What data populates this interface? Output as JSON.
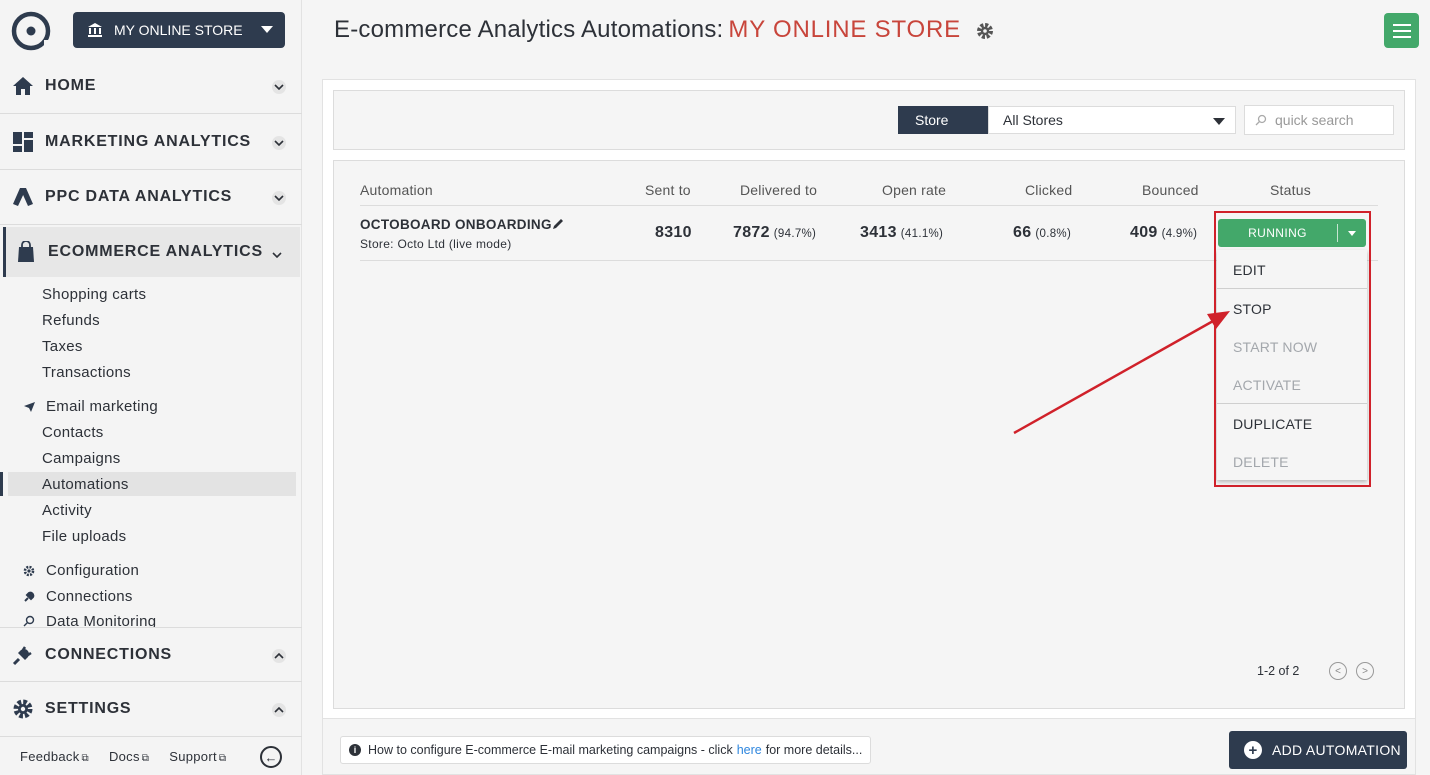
{
  "store_selector": {
    "label": "MY ONLINE STORE"
  },
  "nav": {
    "home": "HOME",
    "marketing": "MARKETING ANALYTICS",
    "ppc": "PPC DATA ANALYTICS",
    "ecommerce": "ECOMMERCE ANALYTICS",
    "ecom_items": [
      "Shopping carts",
      "Refunds",
      "Taxes",
      "Transactions"
    ],
    "email_marketing": "Email marketing",
    "email_items": [
      "Contacts",
      "Campaigns",
      "Automations",
      "Activity",
      "File uploads"
    ],
    "configuration": "Configuration",
    "connections_sub": "Connections",
    "data_monitoring": "Data Monitoring",
    "connections": "CONNECTIONS",
    "settings": "SETTINGS"
  },
  "footer": {
    "feedback": "Feedback",
    "docs": "Docs",
    "support": "Support"
  },
  "header": {
    "title": "E-commerce Analytics Automations:",
    "store": "MY ONLINE STORE"
  },
  "filter": {
    "store_label": "Store",
    "store_value": "All Stores",
    "search_placeholder": "quick search"
  },
  "table": {
    "headers": [
      "Automation",
      "Sent to",
      "Delivered to",
      "Open rate",
      "Clicked",
      "Bounced",
      "Status"
    ],
    "row": {
      "name": "OCTOBOARD ONBOARDING",
      "store": "Store: Octo Ltd (live mode)",
      "sent": "8310",
      "delivered": "7872",
      "delivered_pct": "(94.7%)",
      "open": "3413",
      "open_pct": "(41.1%)",
      "clicked": "66",
      "clicked_pct": "(0.8%)",
      "bounced": "409",
      "bounced_pct": "(4.9%)",
      "status": "RUNNING"
    }
  },
  "dropdown": {
    "edit": "EDIT",
    "stop": "STOP",
    "start_now": "START NOW",
    "activate": "ACTIVATE",
    "duplicate": "DUPLICATE",
    "delete": "DELETE"
  },
  "pager": {
    "text": "1-2 of 2"
  },
  "info": {
    "before": "How to configure E-commerce E-mail marketing campaigns - click",
    "link": "here",
    "after": "for more details..."
  },
  "add_button": "ADD AUTOMATION",
  "colors": {
    "accent": "#c8453b",
    "primary": "#2e3b4e",
    "success": "#43a86a",
    "highlight": "#d0212a"
  }
}
